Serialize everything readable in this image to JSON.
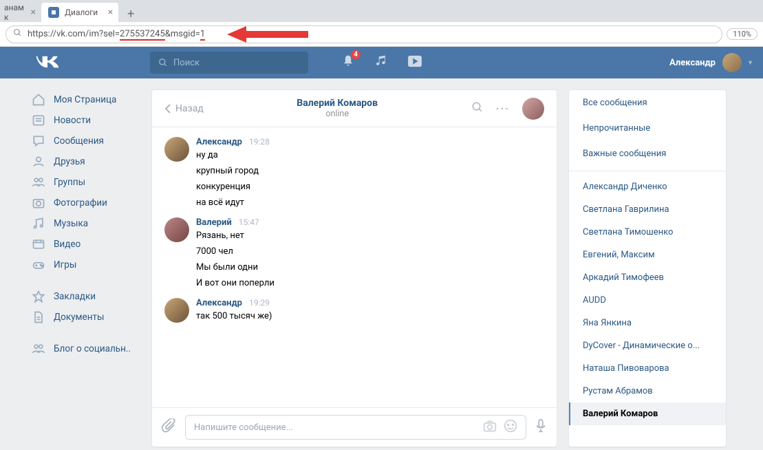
{
  "browser": {
    "tabs": [
      {
        "title": "анам к",
        "active": false
      },
      {
        "title": "Диалоги",
        "active": true
      }
    ],
    "url": "https://vk.com/im?sel=275537245&msgid=1",
    "url_prefix": "https://vk.com/im?sel=",
    "url_sel": "275537245",
    "url_mid_label": "&msgid=",
    "url_msgid": "1",
    "zoom": "110%"
  },
  "header": {
    "search_placeholder": "Поиск",
    "notif_count": "4",
    "user_name": "Александр"
  },
  "sidebar": {
    "items": [
      {
        "icon": "home",
        "label": "Моя Страница"
      },
      {
        "icon": "news",
        "label": "Новости"
      },
      {
        "icon": "messages",
        "label": "Сообщения"
      },
      {
        "icon": "friends",
        "label": "Друзья"
      },
      {
        "icon": "groups",
        "label": "Группы"
      },
      {
        "icon": "photos",
        "label": "Фотографии"
      },
      {
        "icon": "music",
        "label": "Музыка"
      },
      {
        "icon": "video",
        "label": "Видео"
      },
      {
        "icon": "games",
        "label": "Игры"
      }
    ],
    "items2": [
      {
        "icon": "bookmarks",
        "label": "Закладки"
      },
      {
        "icon": "docs",
        "label": "Документы"
      }
    ],
    "items3": [
      {
        "icon": "blog",
        "label": "Блог о социальн.."
      }
    ]
  },
  "chat": {
    "back_label": "Назад",
    "title": "Валерий Комаров",
    "status": "online",
    "groups": [
      {
        "avatar": "a1",
        "author": "Александр",
        "time": "19:28",
        "lines": [
          "ну да",
          "крупный город",
          "конкуренция",
          "на всё идут"
        ]
      },
      {
        "avatar": "a2",
        "author": "Валерий",
        "time": "15:47",
        "lines": [
          "Рязань, нет",
          "7000 чел",
          "Мы были одни",
          "И вот они поперли"
        ]
      },
      {
        "avatar": "a1",
        "author": "Александр",
        "time": "19:29",
        "lines": [
          "так 500 тысяч же)"
        ]
      }
    ],
    "input_placeholder": "Напишите сообщение..."
  },
  "right": {
    "top": [
      "Все сообщения",
      "Непрочитанные",
      "Важные сообщения"
    ],
    "contacts": [
      "Александр Диченко",
      "Светлана Гаврилина",
      "Светлана Тимошенко",
      "Евгений, Максим",
      "Аркадий Тимофеев",
      "AUDD",
      "Яна Янкина",
      "DyCover - Динамические о...",
      "Наташа Пивоварова",
      "Рустам Абрамов",
      "Валерий Комаров"
    ],
    "active_index": 10
  },
  "colors": {
    "vk_blue": "#4a76a8",
    "link": "#2a5885",
    "bg": "#edeef0",
    "red": "#d93025"
  }
}
